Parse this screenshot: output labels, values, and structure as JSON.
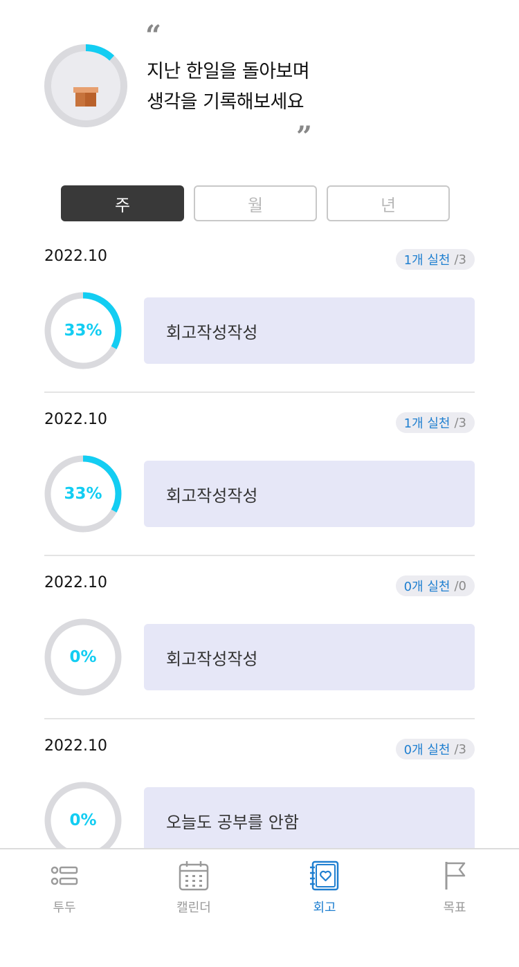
{
  "header": {
    "quote_open": "“",
    "quote_close": "”",
    "line1": "지난 한일을 돌아보며",
    "line2": "생각을 기록해보세요",
    "progress": 0.12
  },
  "segments": [
    {
      "label": "주",
      "active": true
    },
    {
      "label": "월",
      "active": false
    },
    {
      "label": "년",
      "active": false
    }
  ],
  "entries": [
    {
      "date": "2022.10",
      "count_label": "1개 실천",
      "total_label": "/3",
      "percent_label": "33%",
      "percent": 33,
      "text": "회고작성작성"
    },
    {
      "date": "2022.10",
      "count_label": "1개 실천",
      "total_label": "/3",
      "percent_label": "33%",
      "percent": 33,
      "text": "회고작성작성"
    },
    {
      "date": "2022.10",
      "count_label": "0개 실천",
      "total_label": "/0",
      "percent_label": "0%",
      "percent": 0,
      "text": "회고작성작성"
    },
    {
      "date": "2022.10",
      "count_label": "0개 실천",
      "total_label": "/3",
      "percent_label": "0%",
      "percent": 0,
      "text": "오늘도 공부를 안함"
    }
  ],
  "tabbar": {
    "items": [
      {
        "label": "투두",
        "icon": "todo-list-icon",
        "active": false
      },
      {
        "label": "캘린더",
        "icon": "calendar-icon",
        "active": false
      },
      {
        "label": "회고",
        "icon": "retrospect-notebook-icon",
        "active": true
      },
      {
        "label": "목표",
        "icon": "flag-icon",
        "active": false
      }
    ]
  },
  "colors": {
    "accent": "#13cdf2",
    "link": "#1f7fd0",
    "ring_track": "#dadade",
    "card_bg": "#e6e7f7",
    "active_segment": "#393939"
  }
}
